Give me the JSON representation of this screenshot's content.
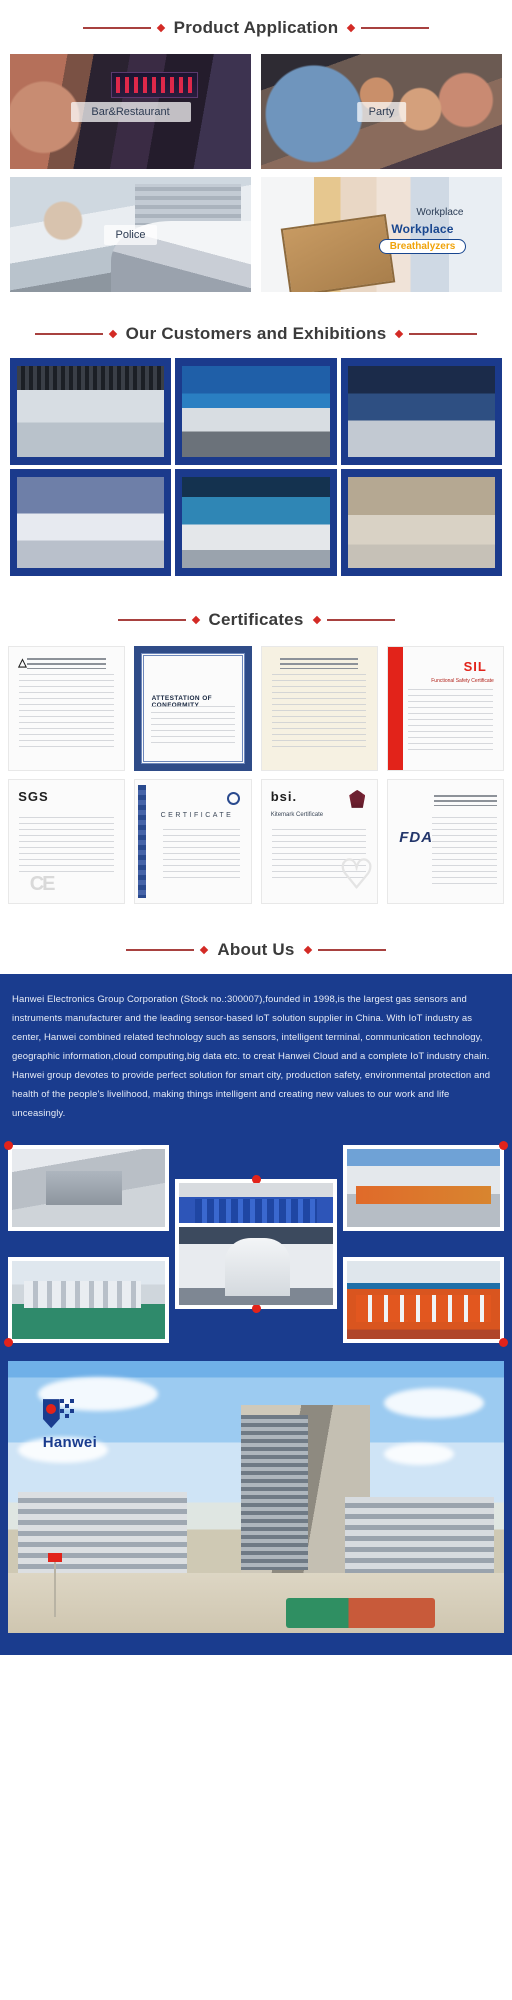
{
  "sections": {
    "product_application": {
      "title": "Product Application"
    },
    "customers": {
      "title": "Our Customers and Exhibitions"
    },
    "certificates": {
      "title": "Certificates"
    },
    "about": {
      "title": "About Us"
    }
  },
  "product_application": {
    "cards": [
      {
        "label": "Bar&Restaurant",
        "scene": "bar-restaurant-photo"
      },
      {
        "label": "Party",
        "scene": "party-photo"
      },
      {
        "label": "Police",
        "scene": "police-roadside-test-photo"
      },
      {
        "label": "Workplace",
        "scene": "workplace-clipboard-photo"
      }
    ],
    "workplace_overlay": {
      "line1": "Workplace",
      "line2": "Breathalyzers"
    }
  },
  "customers": {
    "photos": [
      "exhibition-booth-visitors",
      "exhibition-booth-display",
      "exhibition-group-photo-hexagon-wall",
      "exhibition-booth-hanwei-team",
      "exhibition-booth-hanwei-banner",
      "company-lobby-group-photo"
    ]
  },
  "certificates": {
    "items": [
      {
        "name": "atex-type-examination-certificate",
        "kind": "plain"
      },
      {
        "name": "attestation-of-conformity-certificate",
        "kind": "blue-border",
        "title": "ATTESTATION OF CONFORMITY"
      },
      {
        "name": "measurement-certificate",
        "kind": "cream"
      },
      {
        "name": "sil-functional-safety-certificate",
        "kind": "sil",
        "badge": "SIL",
        "subtitle": "Functional Safety Certificate"
      },
      {
        "name": "sgs-certificate",
        "kind": "sgs",
        "logo": "SGS"
      },
      {
        "name": "iso-certificate",
        "kind": "iso",
        "title": "CERTIFICATE"
      },
      {
        "name": "bsi-kitemark-certificate",
        "kind": "bsi",
        "logo": "bsi.",
        "subtitle": "Kitemark Certificate"
      },
      {
        "name": "fda-registration-certificate",
        "kind": "fda",
        "logo": "FDA"
      }
    ]
  },
  "about": {
    "paragraph": "Hanwei Electronics Group Corporation (Stock no.:300007),founded in 1998,is the largest gas sensors and instruments manufacturer and the leading sensor-based IoT solution supplier in China. With IoT industry as center, Hanwei combined related technology such as sensors, intelligent terminal, communication technology, geographic information,cloud computing,big data etc. to creat Hanwei Cloud and a complete IoT industry chain. Hanwei group devotes to provide perfect solution for smart city, production safety, environmental protection and health of the people's livelihood, making things intelligent and creating new values to our work and life unceasingly."
  },
  "factory": {
    "photos": [
      "smt-production-line",
      "blue-storage-racks-warehouse",
      "assembly-line-workers",
      "clean-room-equipment-row",
      "worker-assembling-detector",
      "orange-gas-detector-assembly"
    ]
  },
  "headquarters": {
    "brand": "Hanwei",
    "logo": "hanwei-logo-mark",
    "photo": "hanwei-headquarters-building"
  },
  "colors": {
    "brand_blue": "#1a3c8e",
    "exhibition_blue": "#1b3a8c",
    "accent_red": "#d32a25",
    "rule_red": "#a8413f",
    "heading_gray": "#3b3b3b",
    "certificate_red": "#e2231a",
    "workplace_gold": "#f0a30a"
  }
}
